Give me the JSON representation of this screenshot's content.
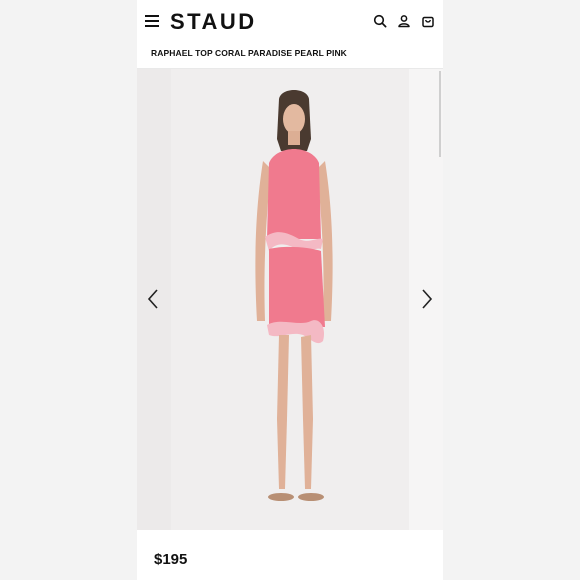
{
  "header": {
    "brand": "STAUD",
    "icons": [
      "menu-icon",
      "search-icon",
      "account-icon",
      "cart-icon"
    ]
  },
  "product": {
    "name": "RAPHAEL TOP CORAL PARADISE PEARL PINK",
    "price": "$195"
  },
  "gallery": {
    "controls": [
      "chevron-left-icon",
      "chevron-right-icon"
    ],
    "colors": {
      "garment_coral": "#f07a8e",
      "trim_pink": "#f4b9c4",
      "background": "#f0eeee"
    }
  }
}
